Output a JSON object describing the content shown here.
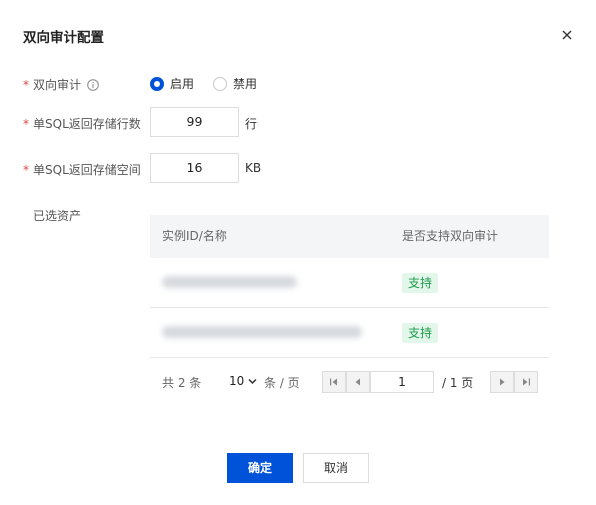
{
  "dialog": {
    "title": "双向审计配置",
    "close_icon": "close-icon"
  },
  "form": {
    "required_mark": "*",
    "audit": {
      "label": "双向审计",
      "info_icon": "info-circle-icon",
      "options": [
        {
          "label": "启用",
          "selected": true
        },
        {
          "label": "禁用",
          "selected": false
        }
      ]
    },
    "rows_limit": {
      "label": "单SQL返回存储行数",
      "value": "99",
      "unit": "行"
    },
    "storage_limit": {
      "label": "单SQL返回存储空间",
      "value": "16",
      "unit": "KB"
    },
    "assets_label": "已选资产"
  },
  "table": {
    "headers": {
      "instance": "实例ID/名称",
      "support": "是否支持双向审计"
    },
    "rows": [
      {
        "instance": "",
        "support": "支持"
      },
      {
        "instance": "",
        "support": "支持"
      }
    ]
  },
  "pagination": {
    "total_text": "共 2 条",
    "page_size": "10",
    "page_size_suffix": "条 / 页",
    "current_page": "1",
    "total_pages_text": "/ 1 页"
  },
  "actions": {
    "confirm": "确定",
    "cancel": "取消"
  },
  "colors": {
    "primary": "#0052d9",
    "required": "#e54545",
    "tag_bg": "#e3f6ea",
    "tag_text": "#1f9b4d"
  }
}
